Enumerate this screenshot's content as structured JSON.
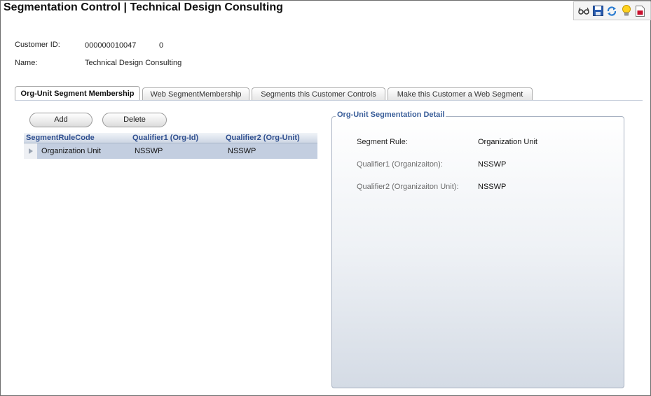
{
  "header": {
    "title": "Segmentation Control | Technical Design Consulting"
  },
  "toolbar": {
    "icons": [
      "glasses-icon",
      "save-icon",
      "refresh-icon",
      "lightbulb-icon",
      "pdf-icon"
    ]
  },
  "customer": {
    "id_label": "Customer ID:",
    "id_value": "000000010047",
    "sub_id": "0",
    "name_label": "Name:",
    "name_value": "Technical Design Consulting"
  },
  "tabs": [
    {
      "label": "Org-Unit Segment Membership",
      "active": true
    },
    {
      "label": "Web SegmentMembership",
      "active": false
    },
    {
      "label": "Segments this Customer Controls",
      "active": false
    },
    {
      "label": "Make this Customer a Web Segment",
      "active": false
    }
  ],
  "buttons": {
    "add": "Add",
    "delete": "Delete"
  },
  "grid": {
    "columns": [
      "SegmentRuleCode",
      "Qualifier1 (Org-Id)",
      "Qualifier2 (Org-Unit)"
    ],
    "rows": [
      [
        "Organization Unit",
        "NSSWP",
        "NSSWP"
      ]
    ]
  },
  "detail": {
    "legend": "Org-Unit Segmentation Detail",
    "fields": [
      {
        "label": "Segment Rule:",
        "value": "Organization Unit"
      },
      {
        "label": "Qualifier1 (Organizaiton):",
        "value": "NSSWP"
      },
      {
        "label": "Qualifier2 (Organizaiton Unit):",
        "value": "NSSWP"
      }
    ]
  },
  "colors": {
    "accent": "#3b5f9a",
    "grid_header_text": "#2f4f8f",
    "selected_row": "#c3cee0"
  }
}
